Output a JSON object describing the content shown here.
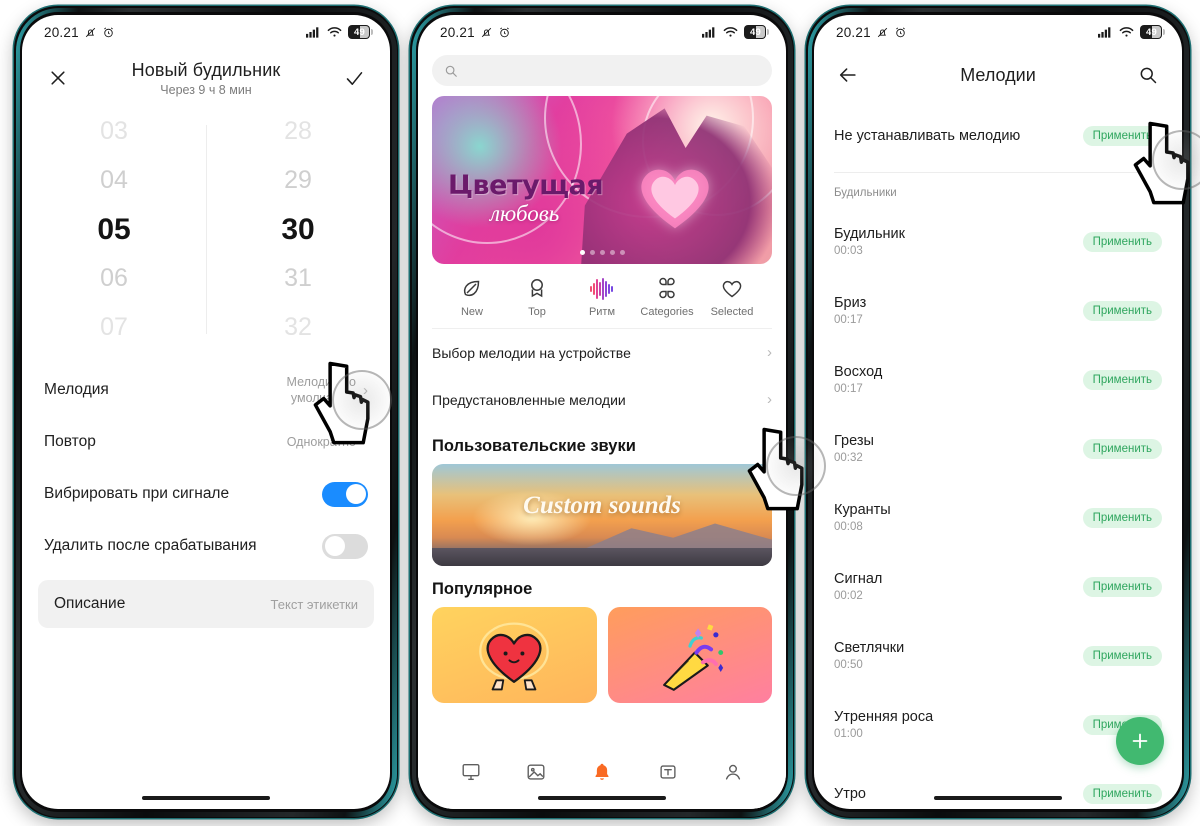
{
  "status_bar": {
    "time": "20.21",
    "battery": "49",
    "mute_icon": "bell-slash-icon",
    "alarm_icon": "alarm-clock-icon",
    "signal_icon": "cellular-signal-icon",
    "wifi_icon": "wifi-icon"
  },
  "phone1": {
    "close_label": "✕",
    "confirm_label": "✓",
    "title": "Новый будильник",
    "subtitle": "Через 9 ч 8 мин",
    "picker": {
      "hours": [
        "03",
        "04",
        "05",
        "06",
        "07"
      ],
      "minutes": [
        "28",
        "29",
        "30",
        "31",
        "32"
      ],
      "selected_hour": "05",
      "selected_minute": "30",
      "selected_index": 2
    },
    "rows": [
      {
        "label": "Мелодия",
        "value": "Мелодия по умолчанию",
        "type": "chevron"
      },
      {
        "label": "Повтор",
        "value": "Однократно",
        "type": "chevron"
      },
      {
        "label": "Вибрировать при сигнале",
        "value": "",
        "type": "toggle_on"
      },
      {
        "label": "Удалить после срабатывания",
        "value": "",
        "type": "toggle_off"
      }
    ],
    "description": {
      "label": "Описание",
      "placeholder": "Текст этикетки"
    }
  },
  "phone2": {
    "search": {
      "placeholder": "",
      "icon": "search-icon"
    },
    "banner": {
      "title_line1": "Цветущая",
      "title_line2": "любовь",
      "dots": 5,
      "active_dot": 0
    },
    "categories": [
      {
        "label": "New",
        "icon": "leaf-icon",
        "active": false
      },
      {
        "label": "Top",
        "icon": "bookmark-icon",
        "active": false
      },
      {
        "label": "Ритм",
        "icon": "equalizer-icon",
        "active": true
      },
      {
        "label": "Categories",
        "icon": "grid-icon",
        "active": false
      },
      {
        "label": "Selected",
        "icon": "heart-icon",
        "active": false
      }
    ],
    "menu_rows": [
      {
        "label": "Выбор мелодии на устройстве"
      },
      {
        "label": "Предустановленные мелодии"
      }
    ],
    "custom_sounds_title": "Пользовательские звуки",
    "custom_sounds_banner_text": "Custom sounds",
    "popular_title": "Популярное",
    "popular_cards": [
      {
        "icon": "heart-character-icon"
      },
      {
        "icon": "party-popper-icon"
      }
    ],
    "nav": [
      {
        "icon": "wallpaper-icon",
        "active": false
      },
      {
        "icon": "image-icon",
        "active": false
      },
      {
        "icon": "bell-icon",
        "active": true
      },
      {
        "icon": "text-icon",
        "active": false
      },
      {
        "icon": "person-icon",
        "active": false
      }
    ]
  },
  "phone3": {
    "back_icon": "arrow-left-icon",
    "title": "Мелодии",
    "search_icon": "search-icon",
    "no_melody": {
      "label": "Не устанавливать мелодию",
      "button": "Применить"
    },
    "group_header": "Будильники",
    "apply_label": "Применить",
    "items": [
      {
        "name": "Будильник",
        "duration": "00:03"
      },
      {
        "name": "Бриз",
        "duration": "00:17"
      },
      {
        "name": "Восход",
        "duration": "00:17"
      },
      {
        "name": "Грезы",
        "duration": "00:32"
      },
      {
        "name": "Куранты",
        "duration": "00:08"
      },
      {
        "name": "Сигнал",
        "duration": "00:02"
      },
      {
        "name": "Светлячки",
        "duration": "00:50"
      },
      {
        "name": "Утренняя роса",
        "duration": "01:00"
      },
      {
        "name": "Утро",
        "duration": ""
      }
    ],
    "fab_label": "+"
  },
  "colors": {
    "accent_blue": "#1a8cff",
    "accent_green": "#41b970",
    "apply_bg": "#ddf5e4",
    "apply_text": "#2fa65e",
    "bell_orange": "#f96a23",
    "frame_teal": "#1d6f72"
  }
}
